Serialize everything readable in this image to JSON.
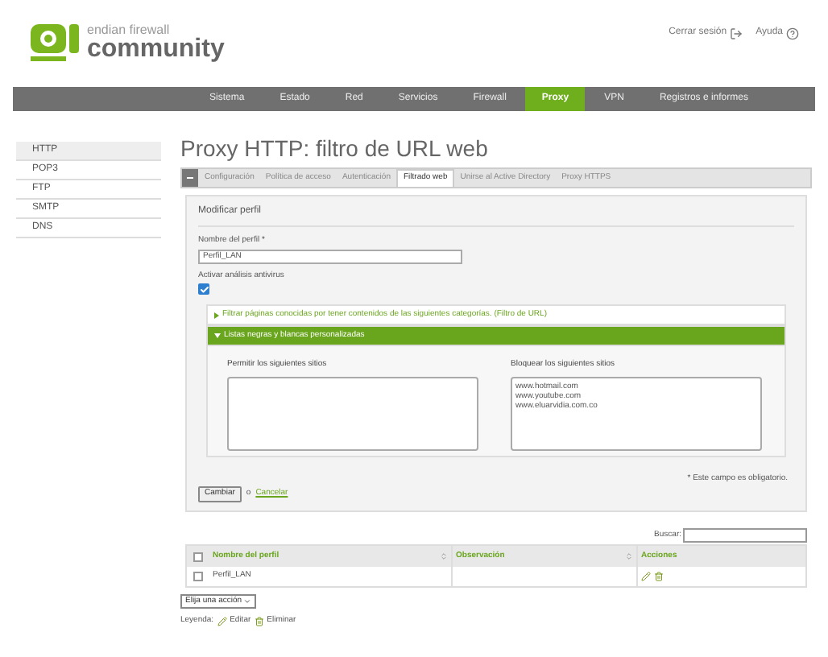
{
  "header": {
    "logo": {
      "line1": "endian firewall",
      "line2": "community"
    },
    "links": [
      {
        "label": "Cerrar sesión",
        "kind": "logout"
      },
      {
        "label": "Ayuda",
        "kind": "help"
      }
    ]
  },
  "nav": [
    {
      "label": "Sistema",
      "selected": false
    },
    {
      "label": "Estado",
      "selected": false
    },
    {
      "label": "Red",
      "selected": false
    },
    {
      "label": "Servicios",
      "selected": false
    },
    {
      "label": "Firewall",
      "selected": false
    },
    {
      "label": "Proxy",
      "selected": true
    },
    {
      "label": "VPN",
      "selected": false
    },
    {
      "label": "Registros e informes",
      "selected": false
    }
  ],
  "sidebar": {
    "items": [
      {
        "label": "HTTP",
        "selected": true
      },
      {
        "label": "POP3",
        "selected": false
      },
      {
        "label": "FTP",
        "selected": false
      },
      {
        "label": "SMTP",
        "selected": false
      },
      {
        "label": "DNS",
        "selected": false
      }
    ]
  },
  "page_title": "Proxy HTTP: filtro de URL web",
  "tabs": [
    {
      "label": "Configuración",
      "selected": false
    },
    {
      "label": "Política de acceso",
      "selected": false
    },
    {
      "label": "Autenticación",
      "selected": false
    },
    {
      "label": "Filtrado web",
      "selected": true
    },
    {
      "label": "Unirse al Active Directory",
      "selected": false
    },
    {
      "label": "Proxy HTTPS",
      "selected": false
    }
  ],
  "form": {
    "section_title": "Modificar perfil",
    "name_label": "Nombre del perfil *",
    "name_value": "Perfil_LAN",
    "antivirus_label": "Activar análisis antivirus",
    "antivirus_checked": true,
    "accordion": [
      {
        "label": "Filtrar páginas conocidas por tener contenidos de las siguientes categorías. (Filtro de URL)",
        "expanded": false
      },
      {
        "label": "Listas negras y blancas personalizadas",
        "expanded": true
      }
    ],
    "lists": [
      {
        "label": "Permitir los siguientes sitios"
      },
      {
        "label": "Bloquear los siguientes sitios",
        "value": "www.hotmail.com\nwww.youtube.com\nwww.eluarvidia.com.co"
      }
    ],
    "required_note": "* Este campo es obligatorio.",
    "submit": "Cambiar",
    "or": "o",
    "cancel": "Cancelar"
  },
  "table": {
    "search_label": "Buscar:",
    "all_checked": false,
    "columns": [
      "Nombre del perfil",
      "Observación",
      "Acciones"
    ],
    "rows": [
      {
        "checked": false,
        "cells": [
          "Perfil_LAN",
          ""
        ]
      }
    ],
    "action_select": "Elija una acción",
    "legend": {
      "label": "Leyenda:",
      "edit": "Editar",
      "delete": "Eliminar"
    }
  }
}
